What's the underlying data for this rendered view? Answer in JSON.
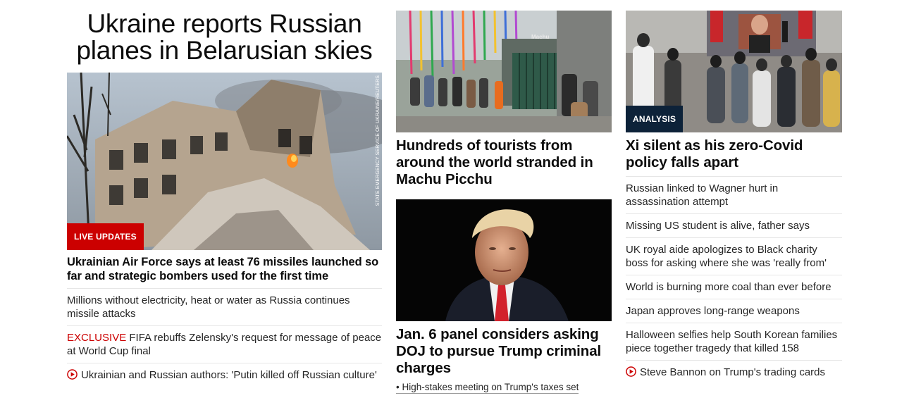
{
  "left": {
    "main_headline": "Ukraine reports Russian planes in Belarusian skies",
    "image_credit": "STATE EMERGENCY SERVICE OF UKRAINE/REUTERS",
    "badge": "LIVE UPDATES",
    "card_headline": "Ukrainian Air Force says at least 76 missiles launched so far and strategic bombers used for the first time",
    "links": [
      {
        "prefix": "",
        "text": "Millions without electricity, heat or water as Russia continues missile attacks"
      },
      {
        "prefix": "EXCLUSIVE",
        "text": " FIFA rebuffs Zelensky's request for message of peace at World Cup final"
      },
      {
        "prefix": "",
        "text": "Ukrainian and Russian authors: 'Putin killed off Russian culture'"
      }
    ]
  },
  "middle": {
    "card1_headline": "Hundreds of tourists from around the world stranded in Machu Picchu",
    "card1_sign": "Machu",
    "card2_headline": "Jan. 6 panel considers asking DOJ to pursue Trump criminal charges",
    "card2_sublink": "• High-stakes meeting on Trump's taxes set"
  },
  "right": {
    "badge": "ANALYSIS",
    "card_headline": "Xi silent as his zero-Covid policy falls apart",
    "links": [
      "Russian linked to Wagner hurt in assassination attempt",
      "Missing US student is alive, father says",
      "UK royal aide apologizes to Black charity boss for asking where she was 'really from'",
      "World is burning more coal than ever before",
      "Japan approves long-range weapons",
      "Halloween selfies help South Korean families piece together tragedy that killed 158",
      "Steve Bannon on Trump's trading cards"
    ]
  },
  "colors": {
    "live_red": "#cc0000",
    "analysis_navy": "#0d2239",
    "text": "#0c0c0c",
    "divider": "#e6e6e6"
  },
  "icons": {
    "video": "play-circle-icon"
  }
}
